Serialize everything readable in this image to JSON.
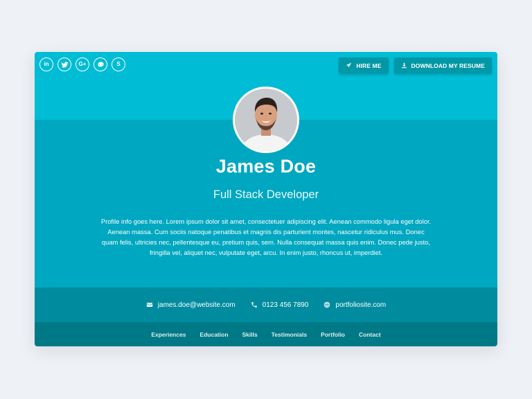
{
  "social": [
    {
      "name": "linkedin",
      "icon": "linkedin-icon",
      "glyph": "in"
    },
    {
      "name": "twitter",
      "icon": "twitter-icon",
      "glyph": ""
    },
    {
      "name": "google-plus",
      "icon": "google-plus-icon",
      "glyph": "G+"
    },
    {
      "name": "github",
      "icon": "github-icon",
      "glyph": ""
    },
    {
      "name": "skype",
      "icon": "skype-icon",
      "glyph": "S"
    }
  ],
  "actions": {
    "hire_me": "Hire Me",
    "download_resume": "Download My Resume"
  },
  "profile": {
    "name": "James Doe",
    "tagline": "Full Stack Developer",
    "bio": "Profile info goes here. Lorem ipsum dolor sit amet, consectetuer adipiscing elit. Aenean commodo ligula eget dolor. Aenean massa. Cum sociis natoque penatibus et magnis dis parturient montes, nascetur ridiculus mus. Donec quam felis, ultricies nec, pellentesque eu, pretium quis, sem. Nulla consequat massa quis enim. Donec pede justo, fringilla vel, aliquet nec, vulputate eget, arcu. In enim justo, rhoncus ut, imperdiet."
  },
  "contacts": {
    "email": "james.doe@website.com",
    "phone": "0123 456 7890",
    "website": "portfoliosite.com"
  },
  "nav": [
    "Experiences",
    "Education",
    "Skills",
    "Testimonials",
    "Portfolio",
    "Contact"
  ],
  "colors": {
    "page_bg": "#eef1f5",
    "band_top": "#00bcd4",
    "band_main": "#00a7c0",
    "band_contact": "#008c9e",
    "band_nav": "#007987",
    "button": "#0097a7"
  }
}
